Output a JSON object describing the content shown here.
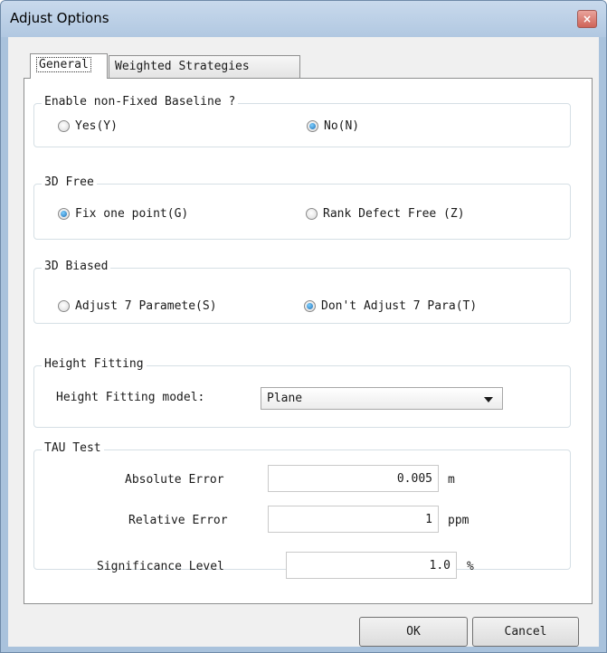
{
  "window": {
    "title": "Adjust Options",
    "close_glyph": "×"
  },
  "tabs": [
    {
      "label": "General",
      "active": true
    },
    {
      "label": "Weighted Strategies",
      "active": false
    }
  ],
  "groups": {
    "non_fixed_baseline": {
      "title": "Enable non-Fixed Baseline ?",
      "options": [
        {
          "label": "Yes(Y)",
          "checked": false
        },
        {
          "label": "No(N)",
          "checked": true
        }
      ]
    },
    "free_3d": {
      "title": "3D Free",
      "options": [
        {
          "label": "Fix one point(G)",
          "checked": true
        },
        {
          "label": "Rank Defect Free (Z)",
          "checked": false
        }
      ]
    },
    "biased_3d": {
      "title": "3D Biased",
      "options": [
        {
          "label": "Adjust 7 Paramete(S)",
          "checked": false
        },
        {
          "label": "Don't Adjust 7 Para(T)",
          "checked": true
        }
      ]
    },
    "height_fitting": {
      "title": "Height Fitting",
      "model_label": "Height Fitting model:",
      "model_value": "Plane"
    },
    "tau_test": {
      "title": "TAU Test",
      "absolute_error_label": "Absolute Error",
      "absolute_error_value": "0.005",
      "absolute_error_unit": "m",
      "relative_error_label": "Relative Error",
      "relative_error_value": "1",
      "relative_error_unit": "ppm"
    }
  },
  "significance": {
    "label": "Significance Level",
    "value": "1.0",
    "unit": "%"
  },
  "buttons": {
    "ok": "OK",
    "cancel": "Cancel"
  }
}
